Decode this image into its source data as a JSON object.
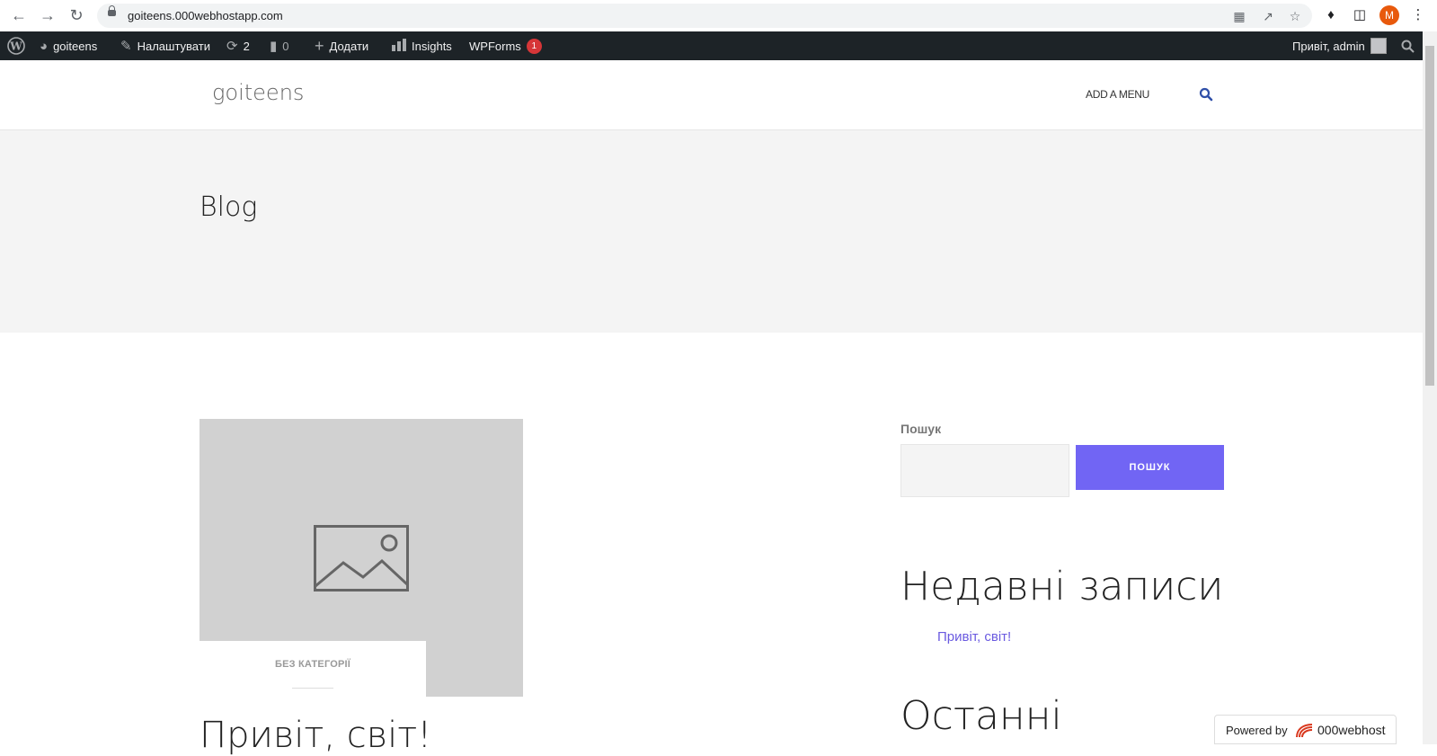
{
  "browser": {
    "url": "goiteens.000webhostapp.com",
    "profile_initial": "M"
  },
  "adminbar": {
    "site_name": "goiteens",
    "customize": "Налаштувати",
    "updates_count": "2",
    "comments_count": "0",
    "add_new": "Додати",
    "insights": "Insights",
    "wpforms": "WPForms",
    "wpforms_badge": "1",
    "greeting": "Привіт, admin"
  },
  "header": {
    "site_title": "goiteens",
    "menu_link": "ADD A MENU"
  },
  "hero": {
    "title": "Blog"
  },
  "post": {
    "category": "БЕЗ КАТЕГОРІЇ",
    "title": "Привіт, світ!"
  },
  "sidebar": {
    "search_label": "Пошук",
    "search_value": "",
    "search_button": "ПОШУК",
    "recent_title": "Недавні записи",
    "recent_items": [
      "Привіт, світ!"
    ],
    "next_widget_title": "Останні"
  },
  "footer_badge": {
    "powered_by": "Powered by",
    "brand": "000webhost"
  },
  "colors": {
    "accent": "#7165f4",
    "adminbar": "#1d2327",
    "hero_bg": "#f4f4f4"
  }
}
